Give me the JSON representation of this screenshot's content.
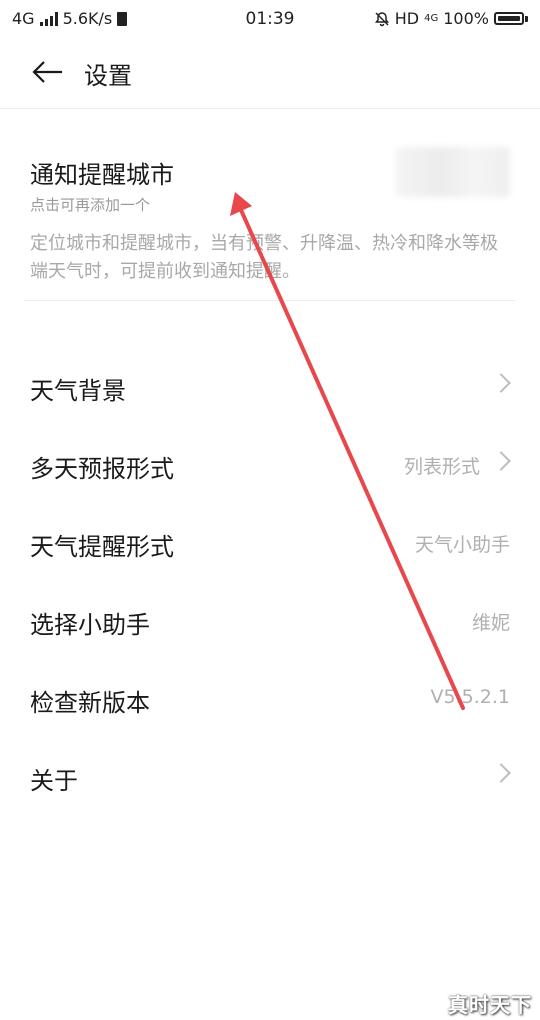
{
  "status_bar": {
    "network": "4G",
    "speed": "5.6K/s",
    "time": "01:39",
    "hd": "HD",
    "net4g": "4G",
    "battery": "100%"
  },
  "header": {
    "title": "设置"
  },
  "notify": {
    "title": "通知提醒城市",
    "subtitle": "点击可再添加一个",
    "description": "定位城市和提醒城市，当有预警、升降温、热冷和降水等极端天气时，可提前收到通知提醒。"
  },
  "settings": [
    {
      "label": "天气背景",
      "value": ""
    },
    {
      "label": "多天预报形式",
      "value": "列表形式"
    },
    {
      "label": "天气提醒形式",
      "value": "天气小助手"
    },
    {
      "label": "选择小助手",
      "value": "维妮"
    },
    {
      "label": "检查新版本",
      "value": "V5.5.2.1"
    },
    {
      "label": "关于",
      "value": ""
    }
  ],
  "annotation": {
    "arrow_color": "#e8474c"
  },
  "watermark": "真时天下"
}
